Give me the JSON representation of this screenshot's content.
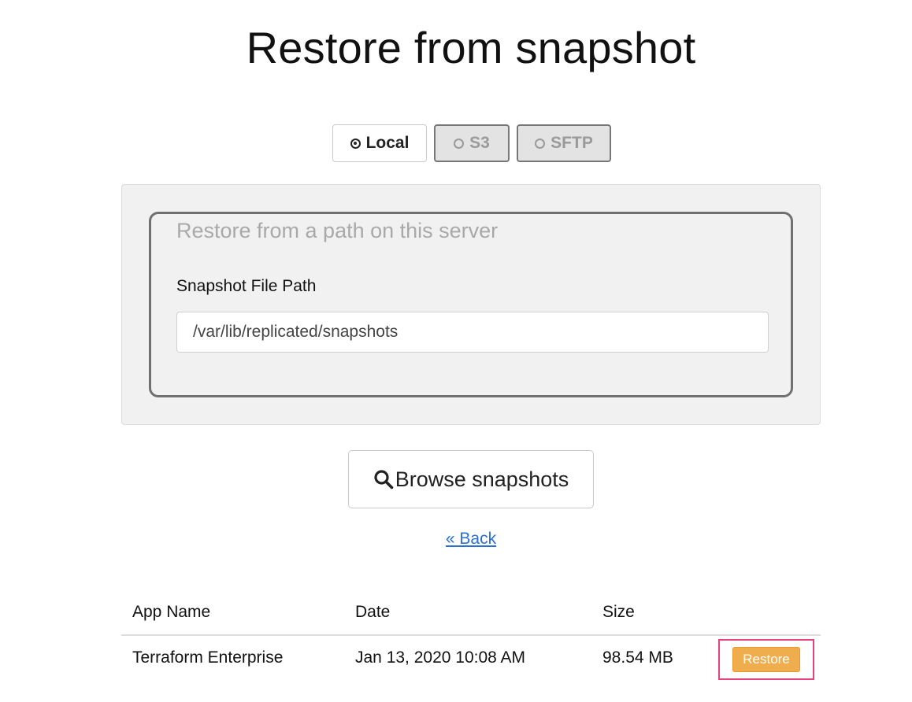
{
  "page": {
    "title": "Restore from snapshot"
  },
  "source_options": {
    "selected": "Local",
    "items": [
      {
        "label": "Local",
        "checked": true,
        "enabled": true
      },
      {
        "label": "S3",
        "checked": false,
        "enabled": false
      },
      {
        "label": "SFTP",
        "checked": false,
        "enabled": false
      }
    ]
  },
  "local_panel": {
    "legend": "Restore from a path on this server",
    "field_label": "Snapshot File Path",
    "path_value": "/var/lib/replicated/snapshots"
  },
  "actions": {
    "browse_label": "Browse snapshots",
    "browse_icon": "search-icon",
    "back_label": "« Back"
  },
  "snapshots_table": {
    "columns": [
      "App Name",
      "Date",
      "Size"
    ],
    "rows": [
      {
        "app_name": "Terraform Enterprise",
        "date": "Jan 13, 2020 10:08 AM",
        "size": "98.54 MB",
        "action_label": "Restore"
      }
    ]
  },
  "colors": {
    "restore_button": "#f0ad4e",
    "link": "#2a6fd1",
    "highlight_outline": "#e8427a",
    "panel_background": "#f1f1f1"
  }
}
